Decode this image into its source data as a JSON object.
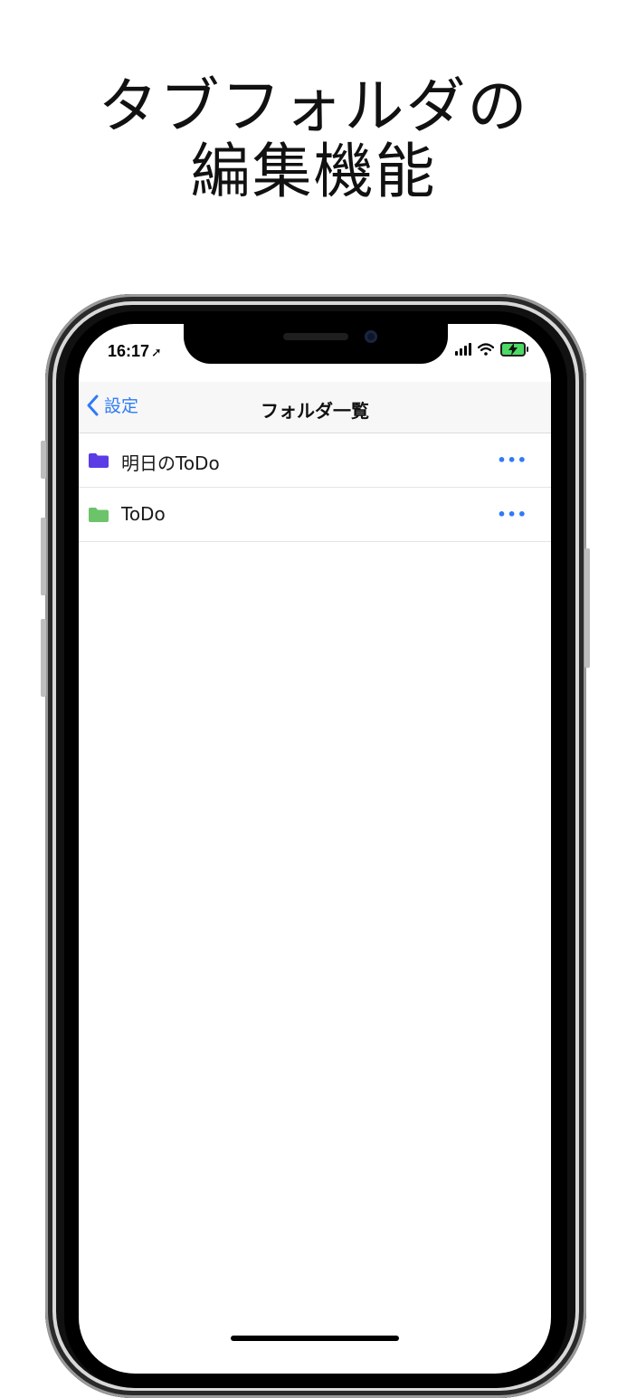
{
  "headline": {
    "line1": "タブフォルダの",
    "line2": "編集機能"
  },
  "status_bar": {
    "time": "16:17",
    "location_glyph": "➚"
  },
  "navbar": {
    "back_label": "設定",
    "title": "フォルダ一覧"
  },
  "folders": [
    {
      "name": "明日のToDo",
      "color": "#5b3be6",
      "more": "•••"
    },
    {
      "name": "ToDo",
      "color": "#6cc36a",
      "more": "•••"
    }
  ],
  "colors": {
    "accent": "#2f7bf6",
    "battery": "#4cd964"
  }
}
